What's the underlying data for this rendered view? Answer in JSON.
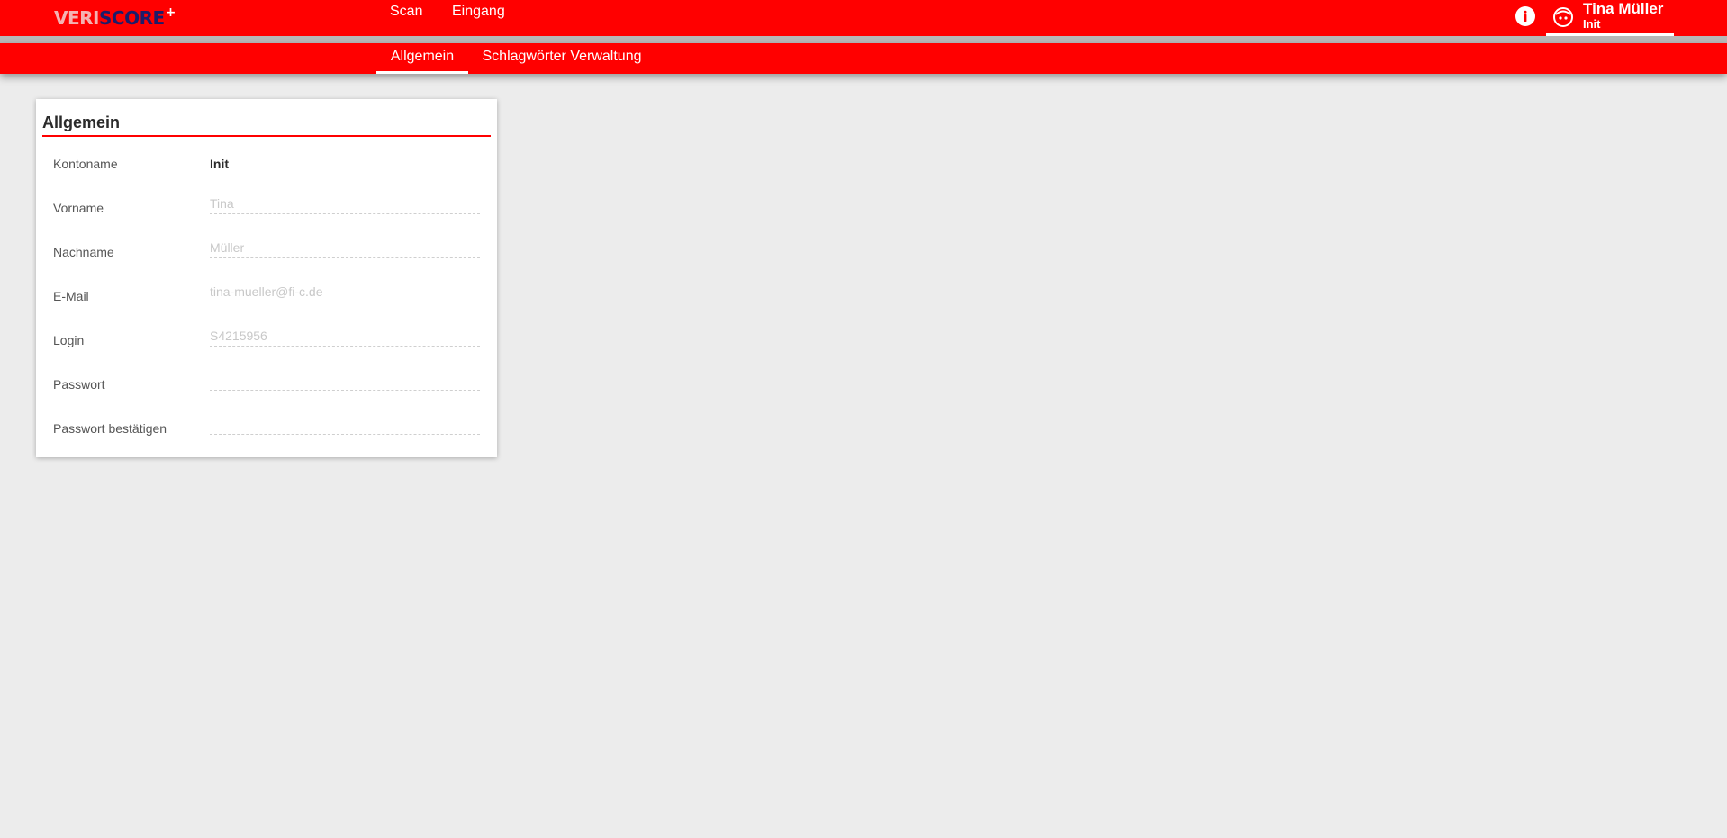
{
  "app": {
    "logo_part1": "VERI",
    "logo_part2": "SCORE",
    "logo_plus": "+"
  },
  "topnav": {
    "items": [
      "Scan",
      "Eingang"
    ]
  },
  "user": {
    "name": "Tina Müller",
    "account": "Init"
  },
  "subnav": {
    "tabs": [
      "Allgemein",
      "Schlagwörter Verwaltung"
    ],
    "active": "Allgemein"
  },
  "card": {
    "title": "Allgemein",
    "kontoname_label": "Kontoname",
    "kontoname_value": "Init",
    "fields": [
      {
        "label": "Vorname",
        "value": "",
        "placeholder": "Tina"
      },
      {
        "label": "Nachname",
        "value": "",
        "placeholder": "Müller"
      },
      {
        "label": "E-Mail",
        "value": "",
        "placeholder": "tina-mueller@fi-c.de"
      },
      {
        "label": "Login",
        "value": "",
        "placeholder": "S4215956"
      },
      {
        "label": "Passwort",
        "value": "",
        "placeholder": ""
      },
      {
        "label": "Passwort bestätigen",
        "value": "",
        "placeholder": ""
      }
    ]
  },
  "colors": {
    "accent": "#ff0000",
    "background": "#ececec",
    "separator": "#b8b8b8"
  },
  "icons": {
    "info": "info-icon",
    "user": "user-avatar-icon"
  }
}
